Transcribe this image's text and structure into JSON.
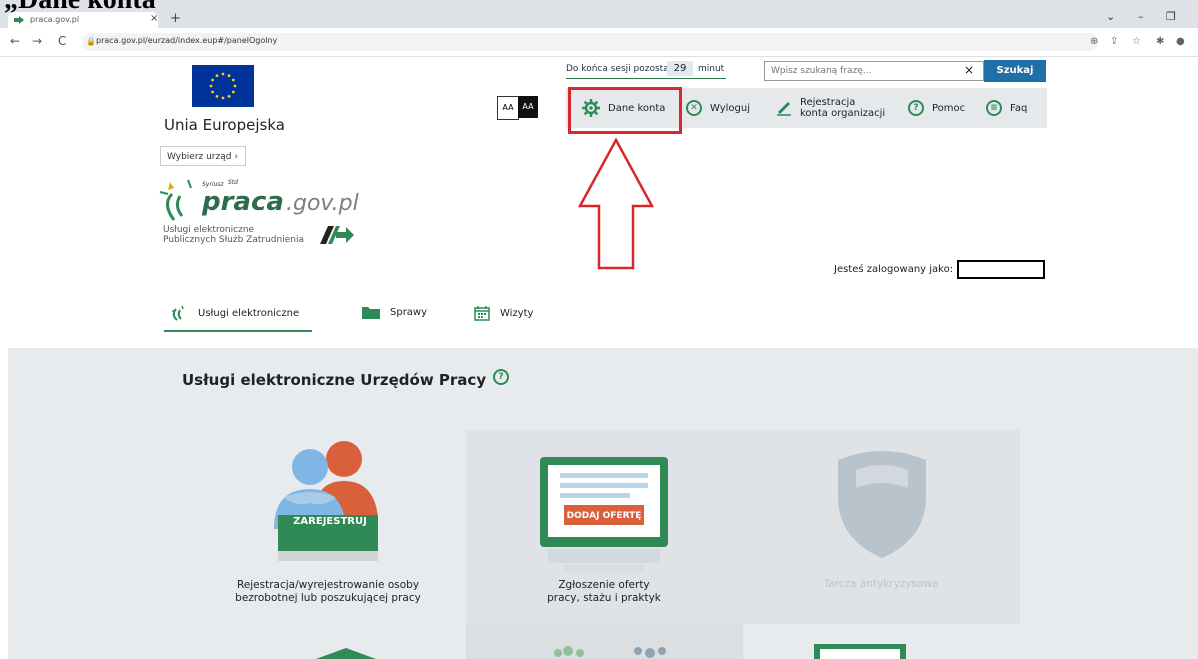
{
  "overlay_heading": "„Dane konta",
  "browser": {
    "tab_title": "praca.gov.pl",
    "tab_close": "×",
    "new_tab": "+",
    "url": "praca.gov.pl/eurzad/index.eup#/panelOgolny",
    "back": "←",
    "forward": "→",
    "reload": "C"
  },
  "header": {
    "eu_label": "Unia Europejska",
    "office_select": "Wybierz urząd  ›",
    "logo_sub_1": "Usługi elektroniczne",
    "logo_sub_2": "Publicznych Służb Zatrudnienia",
    "font_small": "AA",
    "font_large": "AA",
    "session_text": "Do końca sesji pozostało",
    "session_minutes": "29",
    "session_unit": "minut",
    "search_placeholder": "Wpisz szukaną frazę...",
    "search_clear": "×",
    "search_button": "Szukaj"
  },
  "nav": {
    "account": "Dane konta",
    "logout": "Wyloguj",
    "register_org_1": "Rejestracja",
    "register_org_2": "konta organizacji",
    "help": "Pomoc",
    "faq": "Faq"
  },
  "logged_in_label": "Jesteś zalogowany jako:",
  "service_tabs": [
    "Usługi elektroniczne",
    "Sprawy",
    "Wizyty"
  ],
  "section": {
    "title": "Usługi elektroniczne Urzędów Pracy",
    "help": "?"
  },
  "tiles": [
    {
      "button": "ZAREJESTRUJ",
      "label_1": "Rejestracja/wyrejestrowanie osoby",
      "label_2": "bezrobotnej lub poszukującej pracy"
    },
    {
      "button": "DODAJ OFERTĘ",
      "label_1": "Zgłoszenie oferty",
      "label_2": "pracy, stażu i praktyk"
    },
    {
      "label_1": "Tarcza antykryzysowa"
    }
  ],
  "colors": {
    "accent_green": "#2f8a55",
    "highlight_red": "#d9282c",
    "search_blue": "#1f6fa8"
  }
}
